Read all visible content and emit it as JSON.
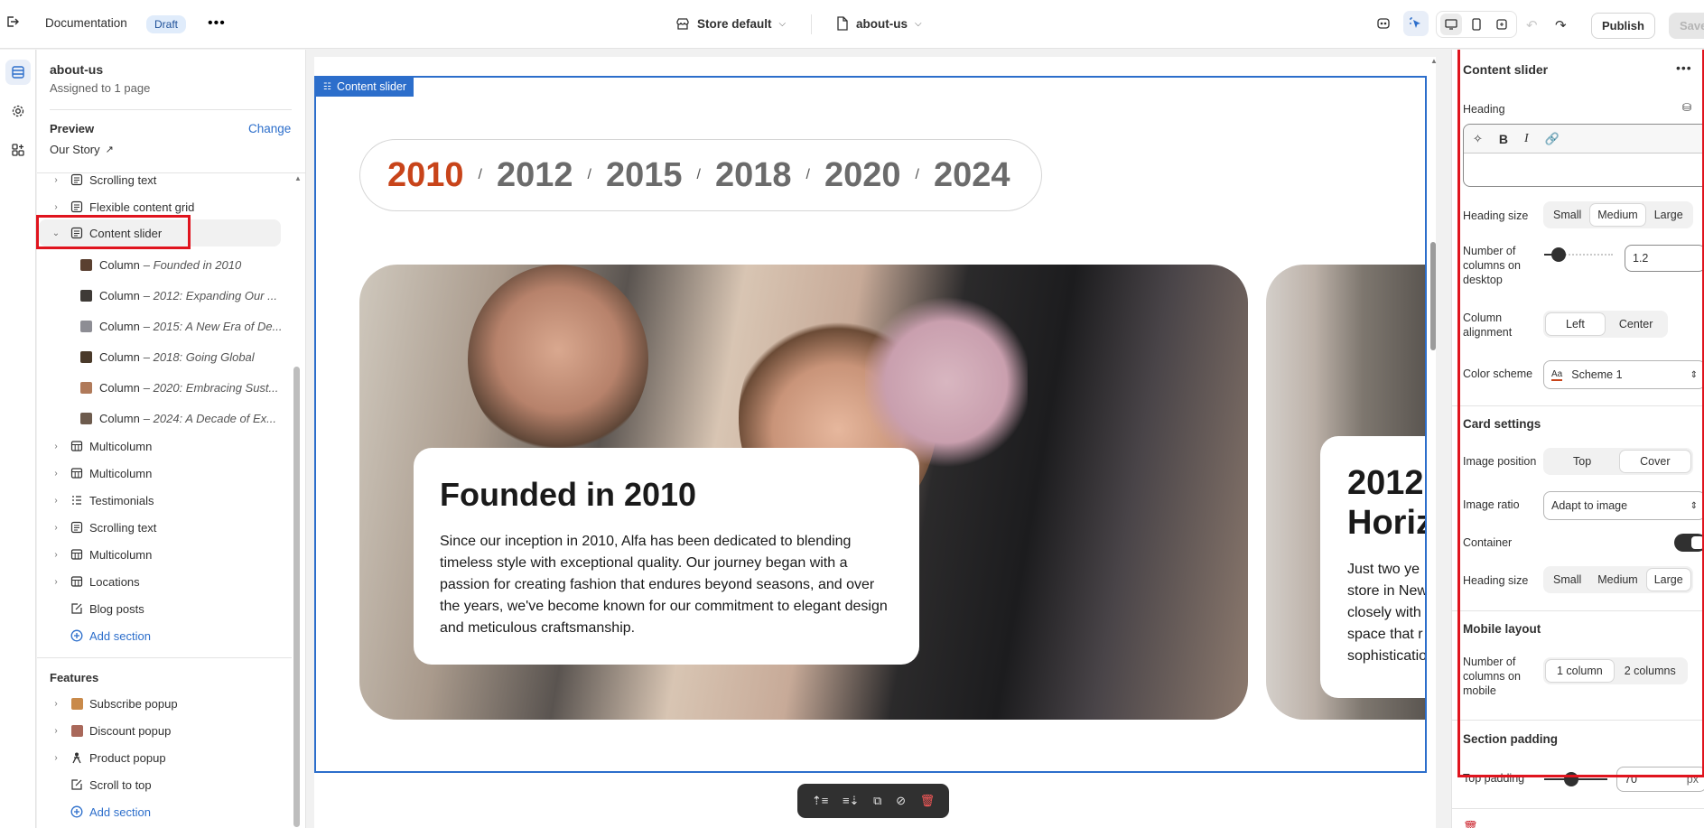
{
  "topbar": {
    "doc_title": "Documentation",
    "draft_badge": "Draft",
    "store_label": "Store default",
    "page_label": "about-us",
    "publish_label": "Publish",
    "save_label": "Save"
  },
  "sidebar": {
    "template_title": "about-us",
    "template_sub": "Assigned to 1 page",
    "preview_label": "Preview",
    "change_label": "Change",
    "preview_value": "Our Story",
    "sections": [
      {
        "label": "Scrolling text",
        "icon": "section-icon"
      },
      {
        "label": "Flexible content grid",
        "icon": "section-icon"
      },
      {
        "label": "Content slider",
        "icon": "section-icon"
      }
    ],
    "columns": [
      {
        "prefix": "Column",
        "sub": "– Founded in 2010"
      },
      {
        "prefix": "Column",
        "sub": "– 2012: Expanding Our ..."
      },
      {
        "prefix": "Column",
        "sub": "– 2015: A New Era of De..."
      },
      {
        "prefix": "Column",
        "sub": "– 2018: Going Global"
      },
      {
        "prefix": "Column",
        "sub": "– 2020: Embracing Sust..."
      },
      {
        "prefix": "Column",
        "sub": "– 2024: A Decade of Ex..."
      }
    ],
    "sections2": [
      {
        "label": "Multicolumn"
      },
      {
        "label": "Multicolumn"
      },
      {
        "label": "Testimonials"
      },
      {
        "label": "Scrolling text"
      },
      {
        "label": "Multicolumn"
      },
      {
        "label": "Locations"
      },
      {
        "label": "Blog posts"
      }
    ],
    "add_section": "Add section",
    "features_title": "Features",
    "features": [
      {
        "label": "Subscribe popup"
      },
      {
        "label": "Discount popup"
      },
      {
        "label": "Product popup"
      },
      {
        "label": "Scroll to top"
      }
    ],
    "add_section2": "Add section"
  },
  "canvas": {
    "section_tag": "Content slider",
    "years": [
      "2010",
      "2012",
      "2015",
      "2018",
      "2020",
      "2024"
    ],
    "active_year_color": "#c8441a",
    "card1_title": "Founded in 2010",
    "card1_body": "Since our inception in 2010, Alfa has been dedicated to blending timeless style with exceptional quality. Our journey began with a passion for creating fashion that endures beyond seasons, and over the years, we've become known for our commitment to elegant design and meticulous craftsmanship.",
    "card2_title_1": "2012:",
    "card2_title_2": "Horiz",
    "card2_lines": [
      "Just two ye",
      "store in New",
      "closely with",
      "space that r",
      "sophisticatio"
    ]
  },
  "settings": {
    "panel_title": "Content slider",
    "heading_label": "Heading",
    "heading_size_label": "Heading size",
    "heading_size_options": [
      "Small",
      "Medium",
      "Large"
    ],
    "heading_size_selected": "Medium",
    "columns_desktop_label": "Number of columns on desktop",
    "columns_desktop_value": "1.2",
    "column_alignment_label": "Column alignment",
    "column_alignment_options": [
      "Left",
      "Center"
    ],
    "column_alignment_selected": "Left",
    "color_scheme_label": "Color scheme",
    "color_scheme_value": "Scheme 1",
    "card_settings_title": "Card settings",
    "image_position_label": "Image position",
    "image_position_options": [
      "Top",
      "Cover"
    ],
    "image_position_selected": "Cover",
    "image_ratio_label": "Image ratio",
    "image_ratio_value": "Adapt to image",
    "container_label": "Container",
    "card_heading_size_label": "Heading size",
    "card_heading_size_options": [
      "Small",
      "Medium",
      "Large"
    ],
    "card_heading_size_selected": "Large",
    "mobile_layout_title": "Mobile layout",
    "columns_mobile_label": "Number of columns on mobile",
    "columns_mobile_options": [
      "1 column",
      "2 columns"
    ],
    "columns_mobile_selected": "1 column",
    "section_padding_title": "Section padding",
    "top_padding_label": "Top padding",
    "top_padding_value": "70",
    "top_padding_unit": "px"
  },
  "highlight_color": "#e0141e",
  "selection_color": "#2c6ecb"
}
